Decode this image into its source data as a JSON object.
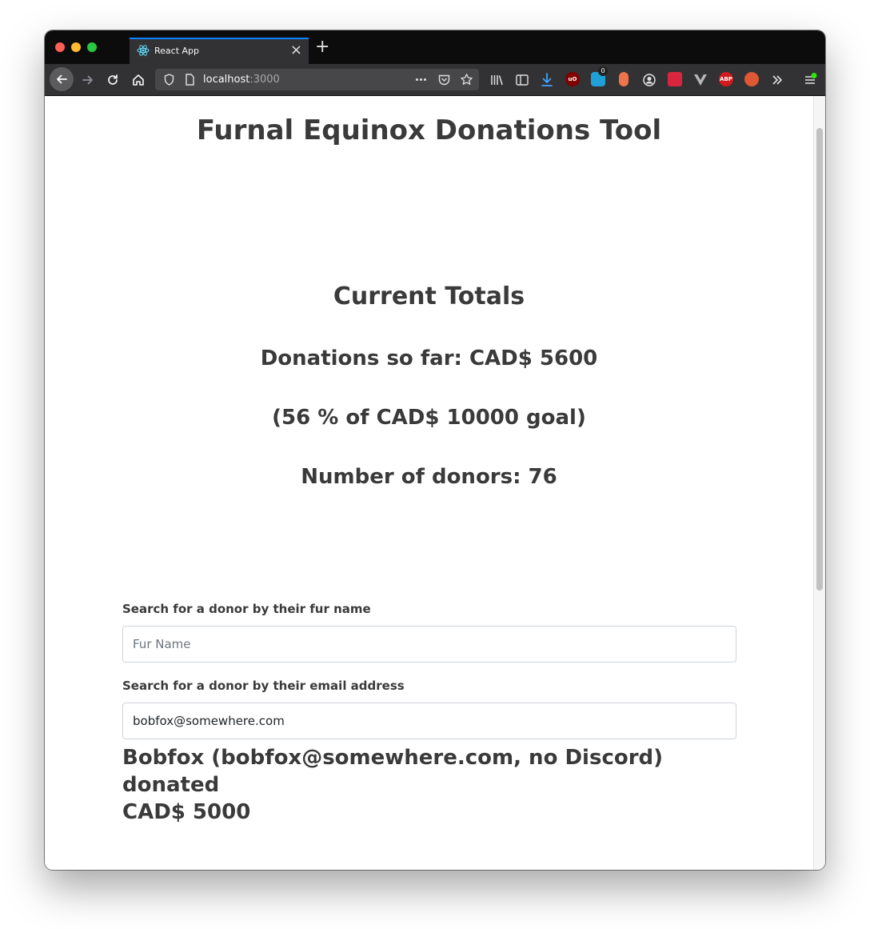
{
  "browser": {
    "tab_title": "React App",
    "url_host": "localhost",
    "url_port": ":3000",
    "badge_count": "0",
    "abp_label": "ABP",
    "ublock_label": "uO"
  },
  "page": {
    "title": "Furnal Equinox Donations Tool",
    "totals_heading": "Current Totals",
    "donations_so_far": "Donations so far: CAD$ 5600",
    "goal_percent": "(56 % of CAD$ 10000 goal)",
    "donor_count": "Number of donors: 76",
    "fur_name_label": "Search for a donor by their fur name",
    "fur_name_placeholder": "Fur Name",
    "fur_name_value": "",
    "email_label": "Search for a donor by their email address",
    "email_value": "bobfox@somewhere.com",
    "result_line1": "Bobfox (bobfox@somewhere.com, no Discord) donated",
    "result_line2": "CAD$ 5000"
  },
  "colors": {
    "accent": "#0a84ff",
    "button_blue": "#0b6efd",
    "text": "#3a3a3a"
  }
}
